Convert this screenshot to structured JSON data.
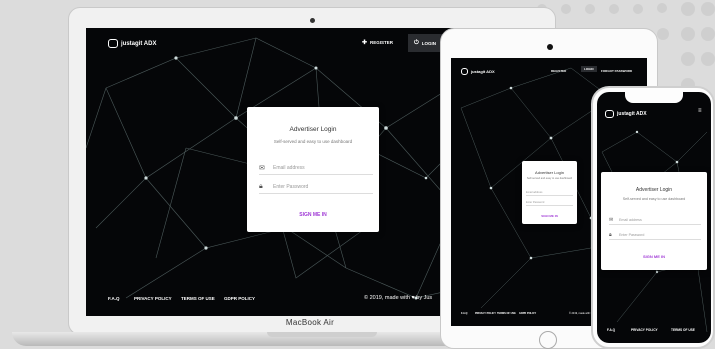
{
  "site": {
    "brand": "justagit ADX",
    "brand_phone": "justagit ADX",
    "nav": {
      "register": "REGISTER",
      "login": "LOGIN",
      "forgot": "FORGOT PASSWORD"
    }
  },
  "login": {
    "title": "Advertiser Login",
    "subtitle": "Self-served and easy to use dashboard",
    "email_placeholder": "Email address",
    "password_placeholder": "Enter Password",
    "signin": "SIGN ME IN"
  },
  "footer": {
    "faq": "F.A.Q",
    "privacy": "PRIVACY POLICY",
    "terms": "TERMS OF USE",
    "gdpr": "GDPR POLICY",
    "copyright": "© 2019, made with ♥ by Jus"
  },
  "device": {
    "laptop_label": "MacBook Air"
  },
  "colors": {
    "accent": "#a13bd6",
    "screen_bg": "#050608"
  },
  "icons": [
    "register-user-icon",
    "login-icon",
    "email-icon",
    "lock-icon",
    "logo-icon",
    "menu-icon"
  ]
}
